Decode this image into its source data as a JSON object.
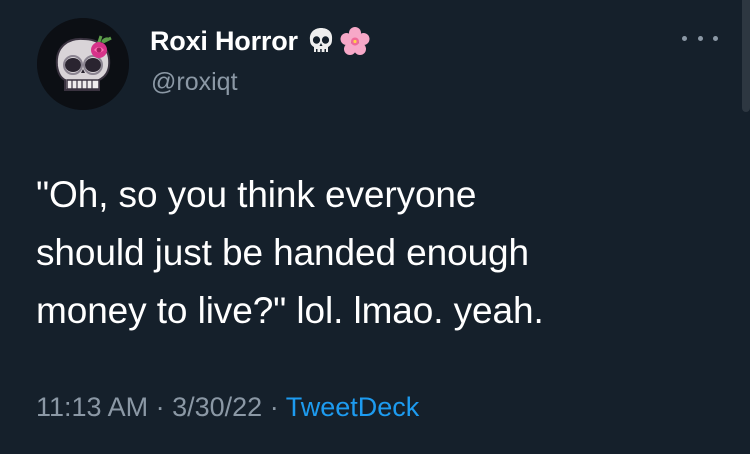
{
  "author": {
    "display_name": "Roxi Horror",
    "handle": "@roxiqt",
    "name_emojis": [
      "skull-emoji",
      "cherry-blossom-emoji"
    ]
  },
  "tweet": {
    "text_lines": [
      "\"Oh, so you think everyone",
      "should just be handed enough",
      "money to live?\" lol. lmao. yeah."
    ],
    "time": "11:13 AM",
    "separator": "·",
    "date": "3/30/22",
    "source": "TweetDeck"
  },
  "colors": {
    "background": "#15202b",
    "text_primary": "#ffffff",
    "text_secondary": "#8b98a5",
    "link": "#1d9bf0"
  },
  "icons": {
    "more": "more-horizontal-icon",
    "avatar": "skull-with-rose-avatar"
  }
}
